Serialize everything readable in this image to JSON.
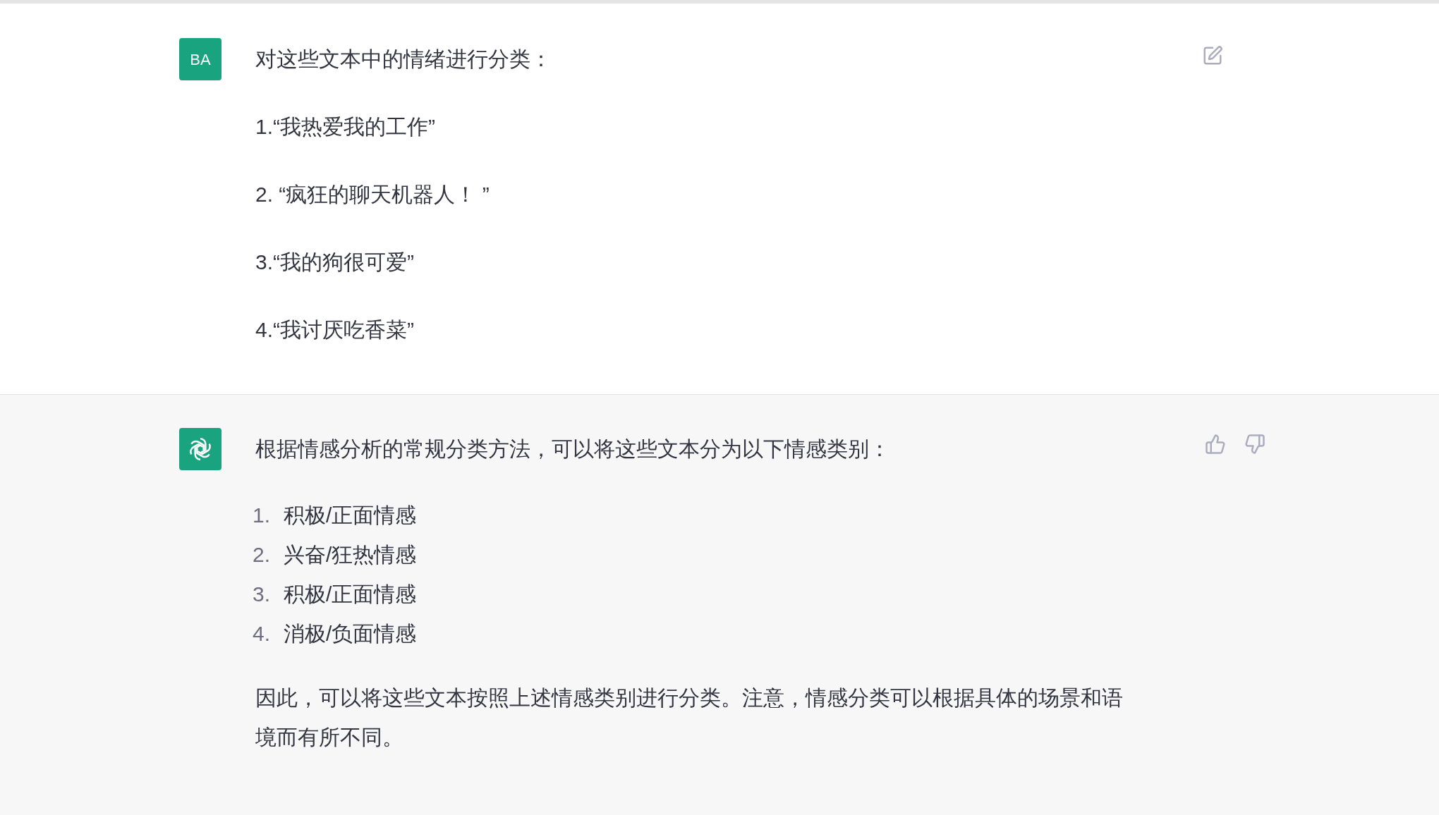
{
  "messages": [
    {
      "kind": "user",
      "avatar": "BA",
      "paragraphs": [
        "对这些文本中的情绪进行分类：",
        "1.“我热爱我的工作”",
        "2. “疯狂的聊天机器人！ ”",
        "3.“我的狗很可爱”",
        "4.“我讨厌吃香菜”"
      ]
    },
    {
      "kind": "assistant",
      "intro": "根据情感分析的常规分类方法，可以将这些文本分为以下情感类别：",
      "list": [
        {
          "number": "1.",
          "text": "积极/正面情感"
        },
        {
          "number": "2.",
          "text": "兴奋/狂热情感"
        },
        {
          "number": "3.",
          "text": "积极/正面情感"
        },
        {
          "number": "4.",
          "text": "消极/负面情感"
        }
      ],
      "paragraphs": [
        "因此，可以将这些文本按照上述情感类别进行分类。注意，情感分类可以根据具体的场景和语境而有所不同。"
      ]
    }
  ]
}
